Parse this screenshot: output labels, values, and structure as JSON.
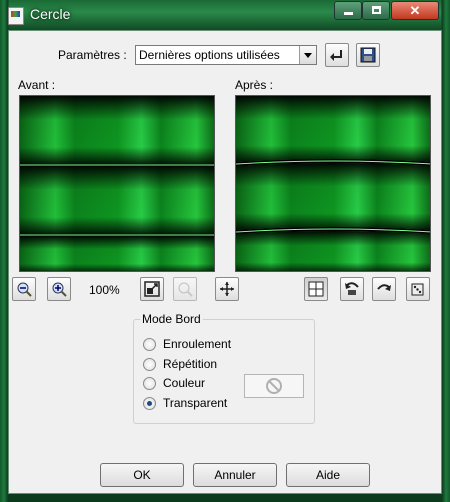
{
  "window": {
    "title": "Cercle",
    "controls": {
      "minimize": "minimize-icon",
      "maximize": "maximize-icon",
      "close": "close-icon"
    }
  },
  "parameters": {
    "label": "Paramètres :",
    "selected": "Dernières options utilisées"
  },
  "preview": {
    "before_label": "Avant :",
    "after_label": "Après :"
  },
  "zoom": {
    "level": "100%"
  },
  "edge_mode": {
    "title": "Mode Bord",
    "options": [
      {
        "label": "Enroulement",
        "checked": false
      },
      {
        "label": "Répétition",
        "checked": false
      },
      {
        "label": "Couleur",
        "checked": false
      },
      {
        "label": "Transparent",
        "checked": true
      }
    ]
  },
  "buttons": {
    "ok": "OK",
    "cancel": "Annuler",
    "help": "Aide"
  },
  "colors": {
    "accent_green": "#22c840",
    "radio_dot": "#1a4a8a"
  }
}
